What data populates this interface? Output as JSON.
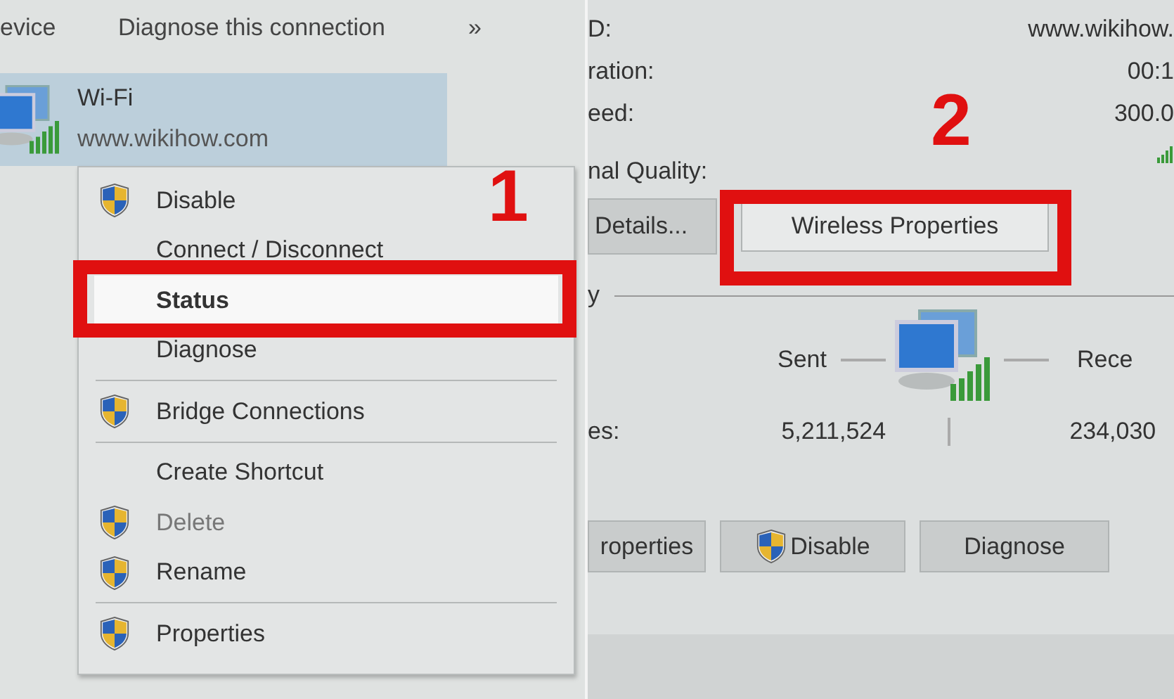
{
  "left_panel": {
    "toolbar": [
      "evice",
      "Diagnose this connection",
      "»"
    ],
    "connection": {
      "name": "Wi-Fi",
      "network": "www.wikihow.com",
      "selected": true
    },
    "context_menu": [
      {
        "kind": "shield",
        "label": "Disable",
        "disabled": false,
        "selected": false
      },
      {
        "kind": "plain",
        "label": "Connect / Disconnect",
        "disabled": false,
        "selected": false
      },
      {
        "kind": "plain",
        "label": "Status",
        "disabled": false,
        "selected": true
      },
      {
        "kind": "plain",
        "label": "Diagnose",
        "disabled": false,
        "selected": false
      },
      {
        "kind": "separator"
      },
      {
        "kind": "shield",
        "label": "Bridge Connections",
        "disabled": false,
        "selected": false
      },
      {
        "kind": "separator"
      },
      {
        "kind": "plain",
        "label": "Create Shortcut",
        "disabled": false,
        "selected": false
      },
      {
        "kind": "shield",
        "label": "Delete",
        "disabled": true,
        "selected": false
      },
      {
        "kind": "shield",
        "label": "Rename",
        "disabled": false,
        "selected": false
      },
      {
        "kind": "separator"
      },
      {
        "kind": "shield",
        "label": "Properties",
        "disabled": false,
        "selected": false
      }
    ]
  },
  "right_panel": {
    "rows": [
      {
        "label": "D:",
        "value": "www.wikihow."
      },
      {
        "label": "ration:",
        "value": "00:1"
      },
      {
        "label": "eed:",
        "value": "300.0"
      }
    ],
    "signal_label": "nal Quality:",
    "buttons_top": [
      {
        "label": "Details..."
      },
      {
        "label": "Wireless Properties"
      }
    ],
    "activity": {
      "title": "y",
      "sent": "Sent",
      "received": "Rece",
      "bytes_label": "es:",
      "bytes_sent": "5,211,524",
      "bytes_received": "234,030"
    },
    "buttons_bottom": [
      {
        "kind": "plain",
        "label": "roperties"
      },
      {
        "kind": "shield",
        "label": "Disable"
      },
      {
        "kind": "plain",
        "label": "Diagnose"
      }
    ]
  },
  "annotations": [
    "1",
    "2"
  ]
}
